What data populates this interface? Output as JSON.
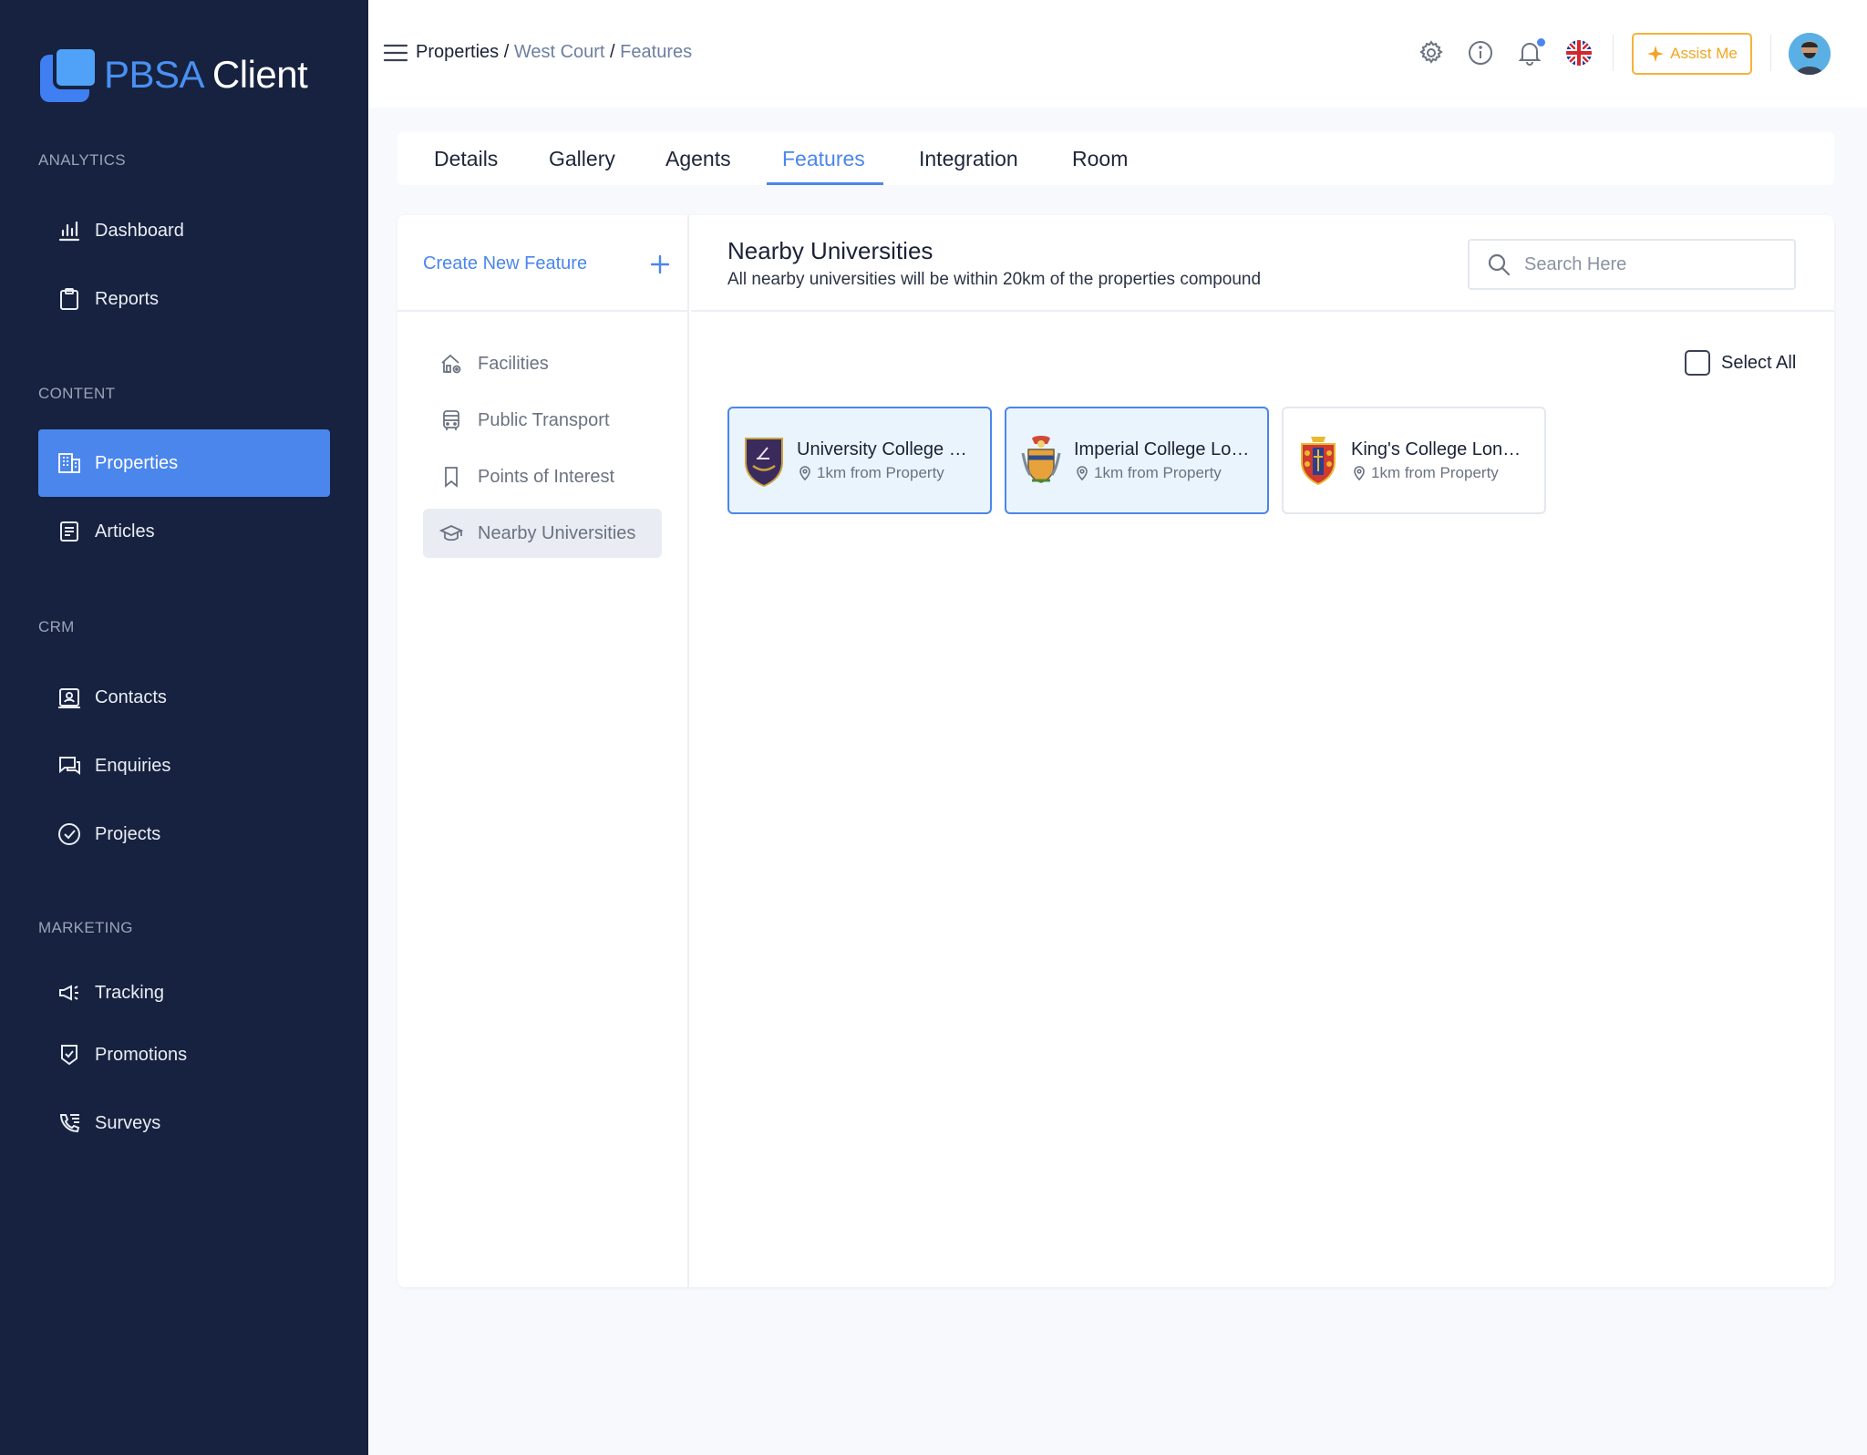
{
  "app": {
    "logo_part1": "PBSA",
    "logo_part2": "Client"
  },
  "sidebar": {
    "sections": {
      "analytics": "ANALYTICS",
      "content": "CONTENT",
      "crm": "CRM",
      "marketing": "MARKETING"
    },
    "items": {
      "dashboard": "Dashboard",
      "reports": "Reports",
      "properties": "Properties",
      "articles": "Articles",
      "contacts": "Contacts",
      "enquiries": "Enquiries",
      "projects": "Projects",
      "tracking": "Tracking",
      "promotions": "Promotions",
      "surveys": "Surveys"
    },
    "active": "properties"
  },
  "header": {
    "breadcrumb": {
      "root": "Properties",
      "sep": " / ",
      "property": "West Court",
      "page": "Features"
    },
    "assist_label": "Assist Me"
  },
  "tabs": {
    "details": "Details",
    "gallery": "Gallery",
    "agents": "Agents",
    "features": "Features",
    "integration": "Integration",
    "room": "Room",
    "active": "features"
  },
  "features_panel": {
    "create_label": "Create New Feature",
    "items": {
      "facilities": "Facilities",
      "public_transport": "Public Transport",
      "points_of_interest": "Points of Interest",
      "nearby_universities": "Nearby Universities"
    },
    "active": "nearby_universities"
  },
  "main": {
    "title": "Nearby Universities",
    "subtitle": "All nearby universities will be within 20km of the properties compound",
    "search_placeholder": "Search Here",
    "select_all_label": "Select All",
    "universities": [
      {
        "name": "University College London",
        "distance": "1km from Property",
        "selected": true
      },
      {
        "name": "Imperial College London",
        "distance": "1km from Property",
        "selected": true
      },
      {
        "name": "King's College London",
        "distance": "1km from Property",
        "selected": false
      }
    ]
  },
  "colors": {
    "sidebar_bg": "#16223f",
    "accent": "#4b86ec",
    "assist": "#f0a623",
    "selected_card_bg": "#eaf4fd"
  }
}
